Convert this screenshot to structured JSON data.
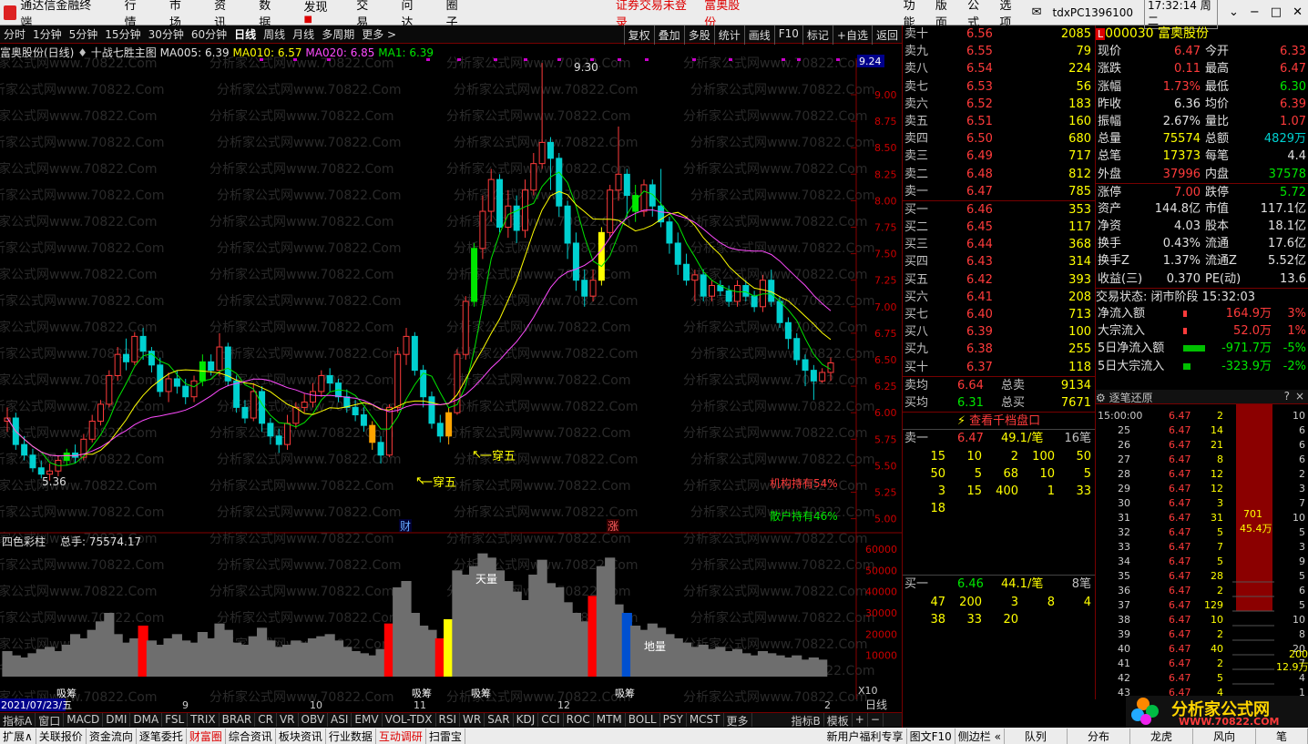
{
  "titlebar": {
    "app": "通达信金融终端",
    "menus": [
      "行情",
      "市场",
      "资讯",
      "数据",
      "发现",
      "交易",
      "问达",
      "圈子"
    ],
    "notice1": "证券交易未登录",
    "notice2": "富奥股份",
    "right": [
      "功能",
      "版面",
      "公式",
      "选项"
    ],
    "user": "tdxPC1396100",
    "clock": "17:32:14 周二"
  },
  "periods": [
    "分时",
    "1分钟",
    "5分钟",
    "15分钟",
    "30分钟",
    "日线",
    "周线",
    "月线",
    "多周期",
    "更多 >"
  ],
  "active_period": "日线",
  "toolbar": [
    "复权",
    "叠加",
    "多股",
    "统计",
    "画线",
    "F10",
    "标记",
    "+自选",
    "返回"
  ],
  "header": {
    "name": "富奥股份(日线)",
    "formula": "十战七胜主图",
    "ma5": "MA005: 6.39",
    "ma10": "MA010: 6.57",
    "ma20": "MA020: 6.85",
    "ma1": "MA1: 6.39"
  },
  "axis_price": [
    "9.00",
    "8.75",
    "8.50",
    "8.25",
    "8.00",
    "7.75",
    "7.50",
    "7.25",
    "7.00",
    "6.75",
    "6.50",
    "6.25",
    "6.00",
    "5.75",
    "5.50",
    "5.25",
    "5.00"
  ],
  "axis_box": "9.24",
  "annotations": {
    "high": "9.30",
    "low": "5.36",
    "c1": "一穿五",
    "c2": "一穿五",
    "inst": "机构持有54%",
    "retail": "散户持有46%",
    "cai": "财",
    "zhang": "涨"
  },
  "vol_header": {
    "name": "四色彩柱",
    "total": "总手: 75574.17"
  },
  "vol_axis": [
    "60000",
    "50000",
    "40000",
    "30000",
    "20000",
    "10000"
  ],
  "vol_labels": {
    "x10": "X10",
    "xi1": "吸筹",
    "xi2": "吸筹",
    "xi3": "吸筹",
    "xi4": "吸筹",
    "tian": "天量",
    "di": "地量"
  },
  "date_axis": {
    "date": "2021/07/23/五",
    "m9": "9",
    "m10": "10",
    "m11": "11",
    "m12": "12",
    "m2": "2",
    "period": "日线"
  },
  "ind_tabs": [
    "指标A",
    "窗口",
    "MACD",
    "DMI",
    "DMA",
    "FSL",
    "TRIX",
    "BRAR",
    "CR",
    "VR",
    "OBV",
    "ASI",
    "EMV",
    "VOL-TDX",
    "RSI",
    "WR",
    "SAR",
    "KDJ",
    "CCI",
    "ROC",
    "MTM",
    "BOLL",
    "PSY",
    "MCST",
    "更多",
    "指标B",
    "模板",
    "+",
    "−"
  ],
  "bottom_tabs": [
    "扩展∧",
    "关联报价",
    "资金流向",
    "逐笔委托",
    "财富圈",
    "综合资讯",
    "板块资讯",
    "行业数据",
    "互动调研",
    "扫雷宝"
  ],
  "bottom_right": [
    "新用户福利专享",
    "图文F10",
    "侧边栏 «",
    "队列",
    "分布",
    "龙虎",
    "风向",
    "笔"
  ],
  "asks": [
    [
      "卖十",
      "6.56",
      "2085"
    ],
    [
      "卖九",
      "6.55",
      "79"
    ],
    [
      "卖八",
      "6.54",
      "224"
    ],
    [
      "卖七",
      "6.53",
      "56"
    ],
    [
      "卖六",
      "6.52",
      "183"
    ],
    [
      "卖五",
      "6.51",
      "160"
    ],
    [
      "卖四",
      "6.50",
      "680"
    ],
    [
      "卖三",
      "6.49",
      "717"
    ],
    [
      "卖二",
      "6.48",
      "812"
    ],
    [
      "卖一",
      "6.47",
      "785"
    ]
  ],
  "bids": [
    [
      "买一",
      "6.46",
      "353"
    ],
    [
      "买二",
      "6.45",
      "117"
    ],
    [
      "买三",
      "6.44",
      "368"
    ],
    [
      "买四",
      "6.43",
      "314"
    ],
    [
      "买五",
      "6.42",
      "393"
    ],
    [
      "买六",
      "6.41",
      "208"
    ],
    [
      "买七",
      "6.40",
      "713"
    ],
    [
      "买八",
      "6.39",
      "100"
    ],
    [
      "买九",
      "6.38",
      "255"
    ],
    [
      "买十",
      "6.37",
      "118"
    ]
  ],
  "avg": {
    "sell_lbl": "卖均",
    "sell": "6.64",
    "tsell_lbl": "总卖",
    "tsell": "9134",
    "buy_lbl": "买均",
    "buy": "6.31",
    "tbuy_lbl": "总买",
    "tbuy": "7671"
  },
  "thousand": "查看千档盘口",
  "q_sell": {
    "lbl": "卖一",
    "p": "6.47",
    "avg": "49.1/笔",
    "cnt": "16笔",
    "rows": [
      [
        "15",
        "10",
        "2",
        "100",
        "50"
      ],
      [
        "50",
        "5",
        "68",
        "10",
        "5"
      ],
      [
        "3",
        "15",
        "400",
        "1",
        "33"
      ],
      [
        "18",
        "",
        "",
        "",
        ""
      ]
    ]
  },
  "q_buy": {
    "lbl": "买一",
    "p": "6.46",
    "avg": "44.1/笔",
    "cnt": "8笔",
    "rows": [
      [
        "47",
        "200",
        "3",
        "8",
        "4"
      ],
      [
        "38",
        "33",
        "20",
        "",
        ""
      ]
    ]
  },
  "stock": {
    "code": "000030",
    "name": "富奥股份"
  },
  "quote": [
    [
      "现价",
      "6.47",
      "今开",
      "6.33"
    ],
    [
      "涨跌",
      "0.11",
      "最高",
      "6.47"
    ],
    [
      "涨幅",
      "1.73%",
      "最低",
      "6.30"
    ],
    [
      "昨收",
      "6.36",
      "均价",
      "6.39"
    ],
    [
      "振幅",
      "2.67%",
      "量比",
      "1.07"
    ],
    [
      "总量",
      "75574",
      "总额",
      "4829万"
    ],
    [
      "总笔",
      "17373",
      "每笔",
      "4.4"
    ],
    [
      "外盘",
      "37996",
      "内盘",
      "37578"
    ],
    [
      "涨停",
      "7.00",
      "跌停",
      "5.72"
    ],
    [
      "资产",
      "144.8亿",
      "市值",
      "117.1亿"
    ],
    [
      "净资",
      "4.03",
      "股本",
      "18.1亿"
    ],
    [
      "换手",
      "0.43%",
      "流通",
      "17.6亿"
    ],
    [
      "换手Z",
      "1.37%",
      "流通Z",
      "5.52亿"
    ],
    [
      "收益(三)",
      "0.370",
      "PE(动)",
      "13.6"
    ]
  ],
  "status": "交易状态: 闭市阶段 15:32:03",
  "flows": [
    [
      "净流入额",
      "164.9万",
      "3%"
    ],
    [
      "大宗流入",
      "52.0万",
      "1%"
    ],
    [
      "5日净流入额",
      "-971.7万",
      "-5%"
    ],
    [
      "5日大宗流入",
      "-323.9万",
      "-2%"
    ]
  ],
  "tick_title": "逐笔还原",
  "ticks": [
    [
      "15:00:00",
      "6.47",
      "2"
    ],
    [
      "25",
      "6.47",
      "14"
    ],
    [
      "26",
      "6.47",
      "21"
    ],
    [
      "27",
      "6.47",
      "8"
    ],
    [
      "28",
      "6.47",
      "12"
    ],
    [
      "29",
      "6.47",
      "12"
    ],
    [
      "30",
      "6.47",
      "3"
    ],
    [
      "31",
      "6.47",
      "31"
    ],
    [
      "32",
      "6.47",
      "5"
    ],
    [
      "33",
      "6.47",
      "7"
    ],
    [
      "34",
      "6.47",
      "5"
    ],
    [
      "35",
      "6.47",
      "28"
    ],
    [
      "36",
      "6.47",
      "2"
    ],
    [
      "37",
      "6.47",
      "129"
    ],
    [
      "38",
      "6.47",
      "10"
    ],
    [
      "39",
      "6.47",
      "2"
    ],
    [
      "40",
      "6.47",
      "40"
    ],
    [
      "41",
      "6.47",
      "2"
    ],
    [
      "42",
      "6.47",
      "5"
    ],
    [
      "43",
      "6.47",
      "4"
    ]
  ],
  "tick_side": [
    "10",
    "6",
    "6",
    "6",
    "2",
    "3",
    "7",
    "10",
    "5",
    "3",
    "9",
    "5",
    "6",
    "5",
    "10",
    "8",
    "20",
    "7",
    "4",
    "1"
  ],
  "tick_big": {
    "n": "701",
    "amt": "45.4万",
    "n2": "200",
    "amt2": "12.9万"
  },
  "brand": {
    "name": "分析家公式网",
    "url": "WWW.70822.COM"
  },
  "watermark": "分析家公式网www.70822.Com"
}
